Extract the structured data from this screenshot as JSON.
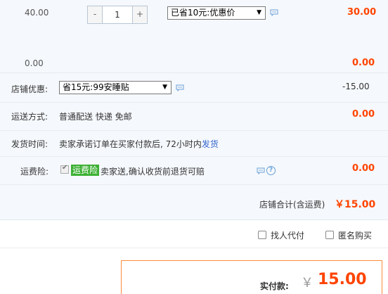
{
  "item": {
    "price_top": "40.00",
    "price_bottom": "0.00",
    "quantity": "1",
    "minus_label": "-",
    "plus_label": "+",
    "promo_select": "已省10元:优惠价",
    "subtotal": "30.00",
    "subtotal_bottom": "0.00"
  },
  "store_discount": {
    "label": "店铺优惠:",
    "select": "省15元:99安睡贴",
    "amount": "-15.00"
  },
  "shipping": {
    "label": "运送方式:",
    "value": "普通配送 快递 免邮",
    "amount": "0.00"
  },
  "delivery": {
    "label": "发货时间:",
    "text": "卖家承诺订单在买家付款后, 72小时内",
    "link": "发货"
  },
  "insurance": {
    "label": "运费险:",
    "badge": "运费险",
    "text": "卖家送,确认收货前退货可赔",
    "amount": "0.00"
  },
  "store_total": {
    "label": "店铺合计(含运费)",
    "amount": "￥15.00"
  },
  "options": {
    "pay_for_me": "找人代付",
    "anonymous": "匿名购买"
  },
  "payment": {
    "label": "实付款:",
    "currency": "￥",
    "amount": "15.00"
  },
  "icons": {
    "message": "message-icon",
    "help": "help-icon",
    "dropdown": "chevron-down-icon"
  },
  "colors": {
    "accent": "#ff4400",
    "link": "#3366cc",
    "row_bg": "#f5f8fc",
    "badge_green": "#3cb034"
  }
}
